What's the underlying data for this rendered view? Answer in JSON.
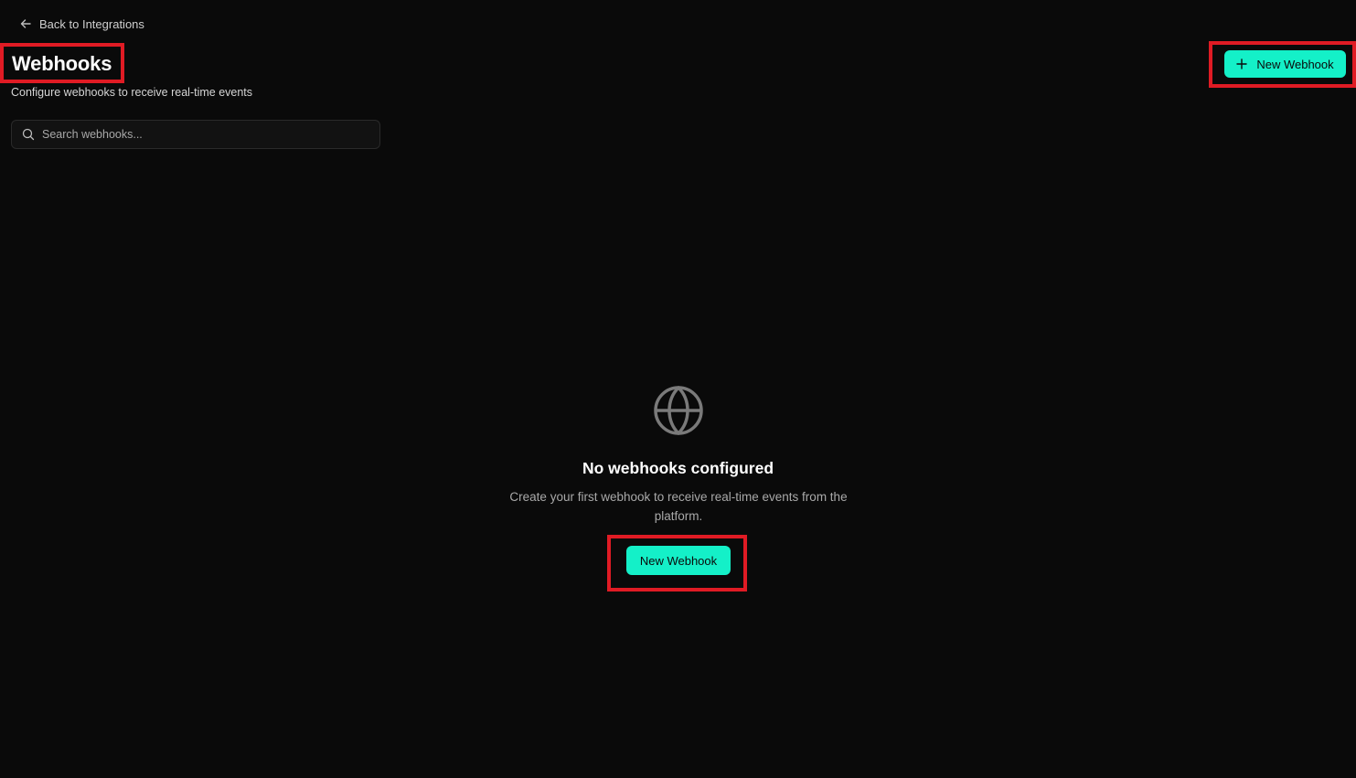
{
  "nav": {
    "back_label": "Back to Integrations"
  },
  "header": {
    "title": "Webhooks",
    "subtitle": "Configure webhooks to receive real-time events",
    "new_button_label": "New Webhook"
  },
  "search": {
    "placeholder": "Search webhooks...",
    "value": ""
  },
  "empty_state": {
    "title": "No webhooks configured",
    "description": "Create your first webhook to receive real-time events from the platform.",
    "button_label": "New Webhook"
  },
  "colors": {
    "background": "#0a0a0a",
    "accent": "#14f0c8",
    "highlight": "#e01b24"
  }
}
